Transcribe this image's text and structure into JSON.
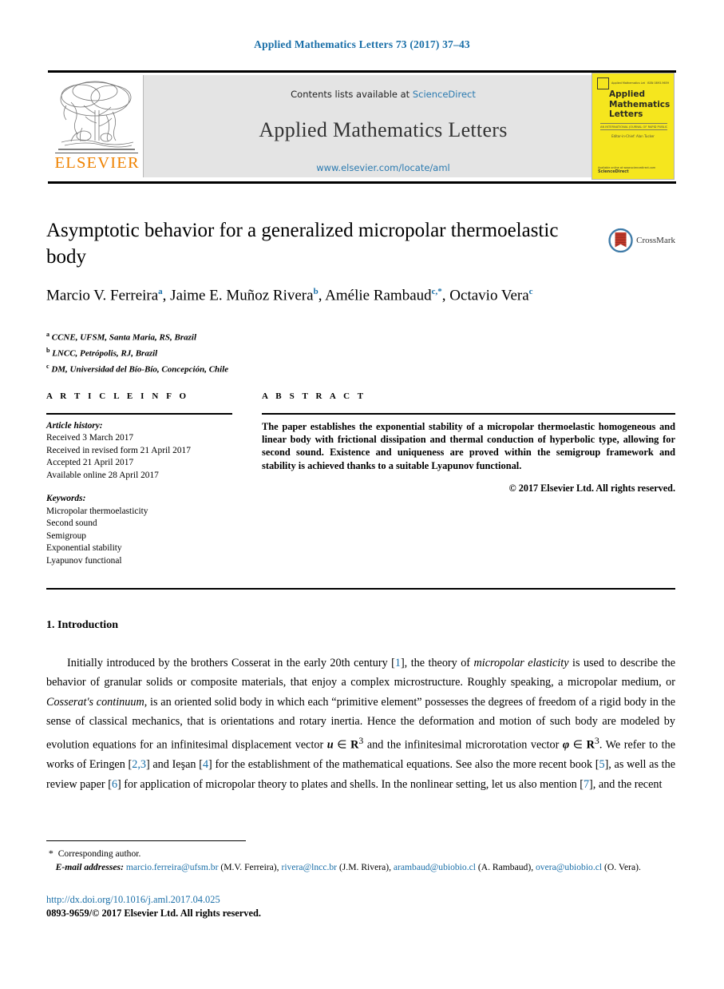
{
  "running_head": "Applied Mathematics Letters 73 (2017) 37–43",
  "masthead": {
    "publisher_logo_label": "ELSEVIER",
    "contents_prefix": "Contents lists available at ",
    "contents_link": "ScienceDirect",
    "journal_name": "Applied Mathematics Letters",
    "journal_url": "www.elsevier.com/locate/aml",
    "cover": {
      "top_left_text": "Applied Mathematics Letters",
      "top_right_text": "ISSN 0893-9659",
      "title_line1": "Applied",
      "title_line2": "Mathematics",
      "title_line3": "Letters",
      "subtitle": "AN INTERNATIONAL JOURNAL OF RAPID PUBLICATION",
      "editor": "Editor-in-Chief: Alan Tucker",
      "foot_line1": "Available online at www.sciencedirect.com",
      "foot_brand": "ScienceDirect"
    }
  },
  "article": {
    "title": "Asymptotic behavior for a generalized micropolar thermoelastic body",
    "crossmark_label": "CrossMark",
    "authors_html": "Marcio V. Ferreira<sup>a</sup>, Jaime E. Muñoz Rivera<sup>b</sup>, Amélie Rambaud<sup>c,</sup><sup>*</sup>, Octavio Vera<sup>c</sup>",
    "affiliations": [
      {
        "mark": "a",
        "text": "CCNE, UFSM, Santa Maria, RS, Brazil"
      },
      {
        "mark": "b",
        "text": "LNCC, Petrópolis, RJ, Brazil"
      },
      {
        "mark": "c",
        "text": "DM, Universidad del Bío-Bío, Concepción, Chile"
      }
    ]
  },
  "article_info": {
    "label": "A R T I C L E  I N F O",
    "history_heading": "Article history:",
    "history": [
      "Received 3 March 2017",
      "Received in revised form 21 April 2017",
      "Accepted 21 April 2017",
      "Available online 28 April 2017"
    ],
    "keywords_heading": "Keywords:",
    "keywords": [
      "Micropolar thermoelasticity",
      "Second sound",
      "Semigroup",
      "Exponential stability",
      "Lyapunov functional"
    ]
  },
  "abstract": {
    "label": "A B S T R A C T",
    "text": "The paper establishes the exponential stability of a micropolar thermoelastic homogeneous and linear body with frictional dissipation and thermal conduction of hyperbolic type, allowing for second sound. Existence and uniqueness are proved within the semigroup framework and stability is achieved thanks to a suitable Lyapunov functional.",
    "copyright": "© 2017 Elsevier Ltd. All rights reserved."
  },
  "body": {
    "section_number_title": "1. Introduction",
    "paragraph_html": "<span class=\"indent\"></span>Initially introduced by the brothers Cosserat in the early 20th century [<span class=\"cite\">1</span>], the theory of <em class=\"it\">micropolar elasticity</em> is used to describe the behavior of granular solids or composite materials, that enjoy a complex microstructure. Roughly speaking, a micropolar medium, or <em class=\"it\">Cosserat's continuum</em>, is an oriented solid body in which each “primitive element” possesses the degrees of freedom of a rigid body in the sense of classical mechanics, that is orientations and rotary inertia. Hence the deformation and motion of such body are modeled by evolution equations for an infinitesimal displacement vector <span class=\"vec\">u</span> ∈ <span class=\"rset\">R</span><sup>3</sup> and the infinitesimal microrotation vector <span class=\"vec\">φ</span> ∈ <span class=\"rset\">R</span><sup>3</sup>. We refer to the works of Eringen [<span class=\"cite\">2,3</span>] and Ieşan [<span class=\"cite\">4</span>] for the establishment of the mathematical equations. See also the more recent book [<span class=\"cite\">5</span>], as well as the review paper [<span class=\"cite\">6</span>] for application of micropolar theory to plates and shells. In the nonlinear setting, let us also mention [<span class=\"cite\">7</span>], and the recent"
  },
  "footnotes": {
    "corresponding": "Corresponding author.",
    "email_label": "E-mail addresses:",
    "emails": [
      {
        "address": "marcio.ferreira@ufsm.br",
        "owner": "(M.V. Ferreira)"
      },
      {
        "address": "rivera@lncc.br",
        "owner": "(J.M. Rivera)"
      },
      {
        "address": "arambaud@ubiobio.cl",
        "owner": "(A. Rambaud)"
      },
      {
        "address": "overa@ubiobio.cl",
        "owner": "(O. Vera)"
      }
    ]
  },
  "doi": {
    "url": "http://dx.doi.org/10.1016/j.aml.2017.04.025",
    "issn_copyright": "0893-9659/© 2017 Elsevier Ltd. All rights reserved."
  },
  "colors": {
    "link_blue": "#1a6fa8",
    "sciencedirect_blue": "#2a7ab0",
    "elsevier_orange": "#ef8200",
    "cover_yellow": "#f5e61e",
    "crossmark_red": "#c0392b",
    "crossmark_blue": "#3f7ba8"
  }
}
